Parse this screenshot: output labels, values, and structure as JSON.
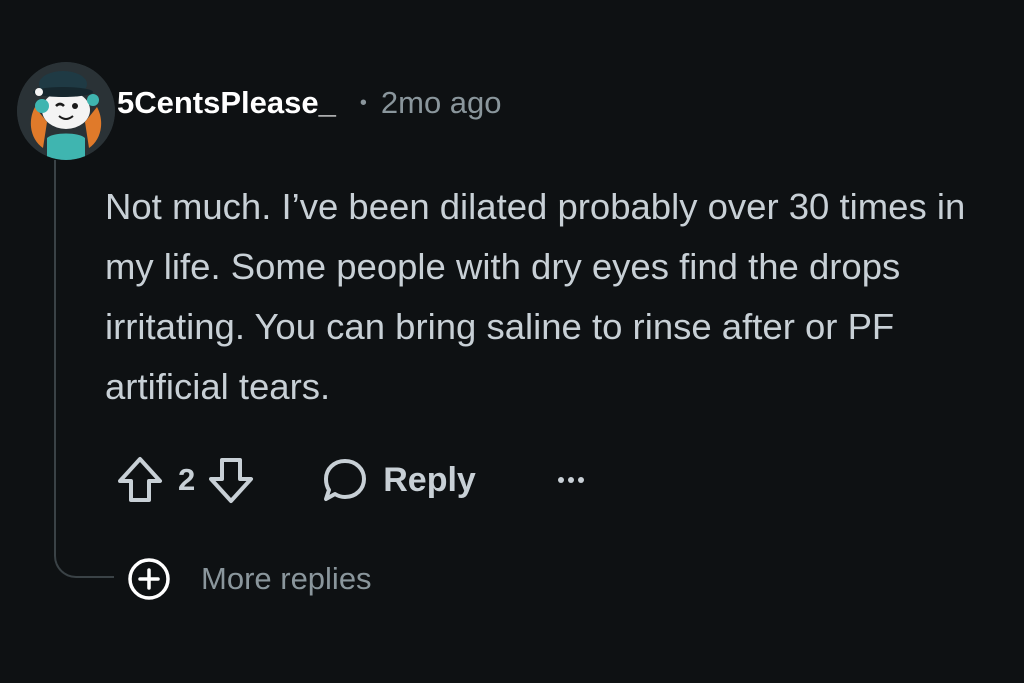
{
  "comment": {
    "username": "5CentsPlease_",
    "separator": "•",
    "time": "2mo ago",
    "body": "Not much. I’ve been dilated probably over 30 times in my life. Some people with dry eyes find the drops irritating. You can bring saline to rinse after or PF artificial tears.",
    "avatar_icon": "snoo-avatar-icon"
  },
  "actions": {
    "upvote_icon": "arrow-up-icon",
    "vote_count": "2",
    "downvote_icon": "arrow-down-icon",
    "reply_icon": "speech-bubble-icon",
    "reply_label": "Reply",
    "more_icon": "ellipsis-icon"
  },
  "more_replies": {
    "icon": "plus-circle-icon",
    "label": "More replies"
  },
  "colors": {
    "background": "#0e1113",
    "text": "#c8d0d6",
    "muted": "#8a969c",
    "username": "#ffffff",
    "thread_line": "#3a4246"
  }
}
